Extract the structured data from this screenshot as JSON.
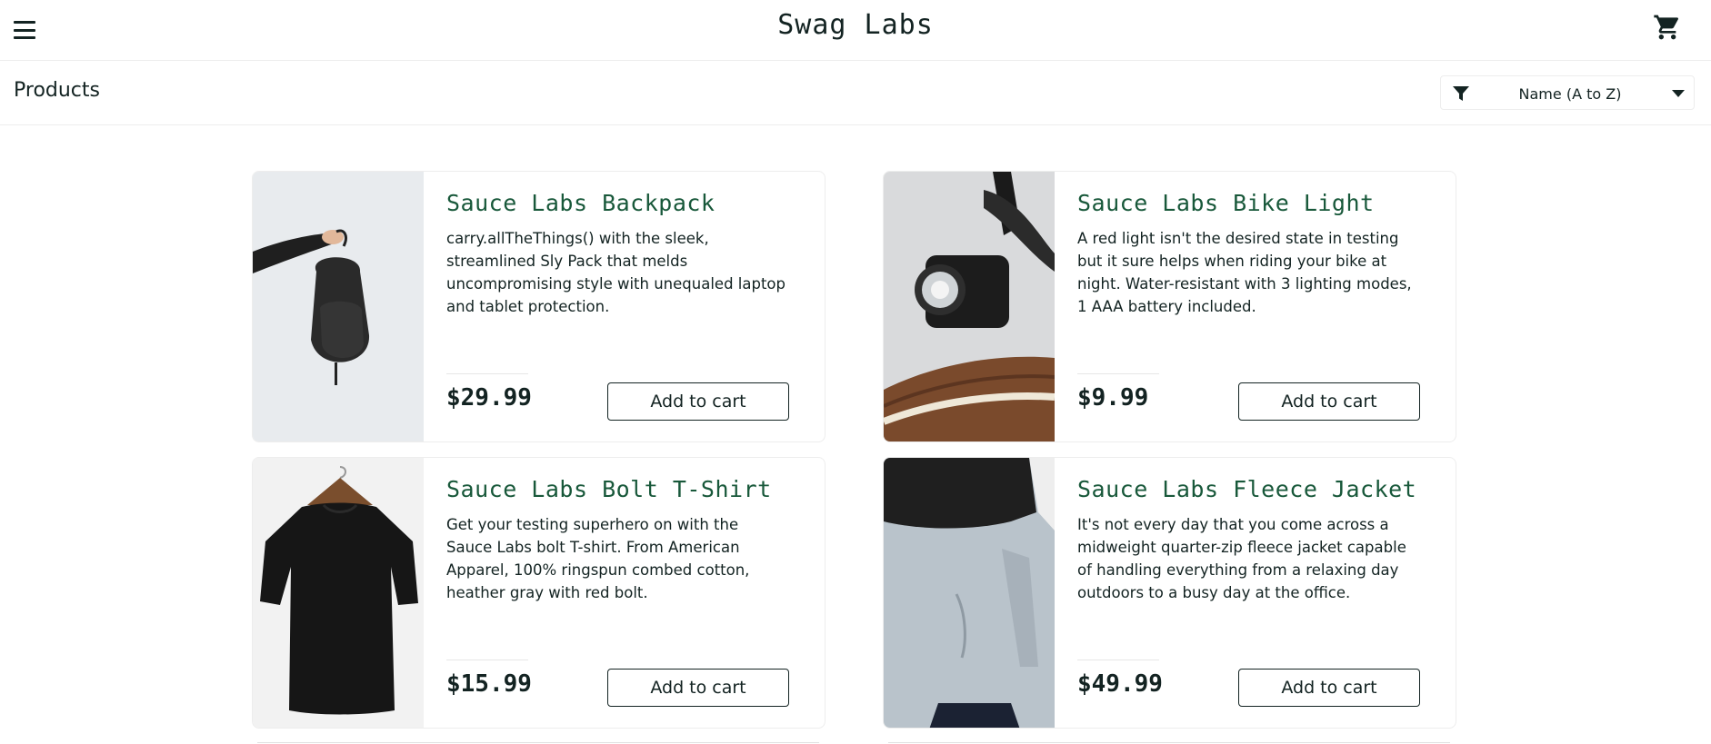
{
  "header": {
    "title": "Swag Labs",
    "menu_icon": "hamburger-menu-icon",
    "cart_icon": "shopping-cart-icon"
  },
  "subheader": {
    "title": "Products",
    "sort": {
      "icon": "filter-icon",
      "selected": "Name (A to Z)",
      "caret_icon": "caret-down-icon"
    }
  },
  "colors": {
    "item_name": "#18583a",
    "text": "#132322",
    "border": "#ededed"
  },
  "products": [
    {
      "name": "Sauce Labs Backpack",
      "description": "carry.allTheThings() with the sleek, streamlined Sly Pack that melds uncompromising style with unequaled laptop and tablet protection.",
      "price": "$29.99",
      "button": "Add to cart",
      "image": "backpack-image"
    },
    {
      "name": "Sauce Labs Bike Light",
      "description": "A red light isn't the desired state in testing but it sure helps when riding your bike at night. Water-resistant with 3 lighting modes, 1 AAA battery included.",
      "price": "$9.99",
      "button": "Add to cart",
      "image": "bike-light-image"
    },
    {
      "name": "Sauce Labs Bolt T-Shirt",
      "description": "Get your testing superhero on with the Sauce Labs bolt T-shirt. From American Apparel, 100% ringspun combed cotton, heather gray with red bolt.",
      "price": "$15.99",
      "button": "Add to cart",
      "image": "tshirt-image"
    },
    {
      "name": "Sauce Labs Fleece Jacket",
      "description": "It's not every day that you come across a midweight quarter-zip fleece jacket capable of handling everything from a relaxing day outdoors to a busy day at the office.",
      "price": "$49.99",
      "button": "Add to cart",
      "image": "fleece-jacket-image"
    }
  ]
}
